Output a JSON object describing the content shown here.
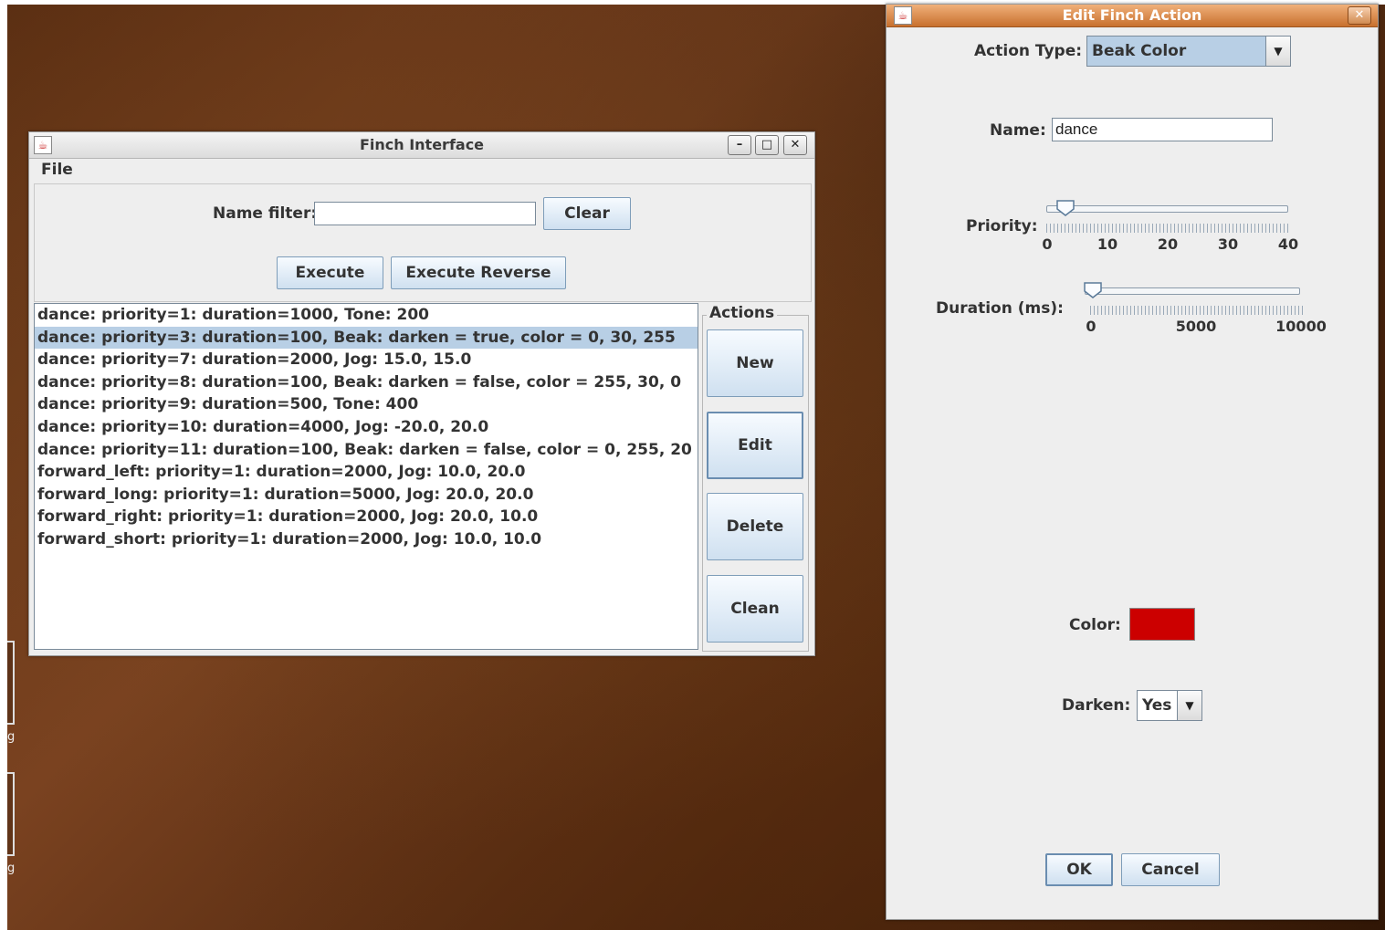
{
  "finch_window": {
    "title": "Finch Interface",
    "menu": {
      "file": "File"
    },
    "name_filter_label": "Name filter:",
    "name_filter_value": "",
    "clear_button": "Clear",
    "execute_button": "Execute",
    "execute_reverse_button": "Execute Reverse",
    "actions_group_title": "Actions",
    "new_button": "New",
    "edit_button": "Edit",
    "delete_button": "Delete",
    "clean_button": "Clean",
    "selected_index": 1,
    "items": [
      "dance: priority=1: duration=1000, Tone: 200",
      "dance: priority=3: duration=100, Beak: darken = true, color = 0, 30, 255",
      "dance: priority=7: duration=2000, Jog: 15.0, 15.0",
      "dance: priority=8: duration=100, Beak: darken = false, color = 255, 30, 0",
      "dance: priority=9: duration=500, Tone: 400",
      "dance: priority=10: duration=4000, Jog: -20.0, 20.0",
      "dance: priority=11: duration=100, Beak: darken = false, color = 0, 255, 20",
      "forward_left: priority=1: duration=2000, Jog: 10.0, 20.0",
      "forward_long: priority=1: duration=5000, Jog: 20.0, 20.0",
      "forward_right: priority=1: duration=2000, Jog: 20.0, 10.0",
      "forward_short: priority=1: duration=2000, Jog: 10.0, 10.0"
    ]
  },
  "edit_window": {
    "title": "Edit Finch Action",
    "action_type_label": "Action Type:",
    "action_type_value": "Beak Color",
    "name_label": "Name:",
    "name_value": "dance",
    "priority_label": "Priority:",
    "priority": {
      "value": 3,
      "min": 0,
      "max": 40,
      "tick_labels": [
        "0",
        "10",
        "20",
        "30",
        "40"
      ]
    },
    "duration_label": "Duration (ms):",
    "duration": {
      "value": 100,
      "min": 0,
      "max": 10000,
      "tick_labels": [
        "0",
        "5000",
        "10000"
      ]
    },
    "color_label": "Color:",
    "color_value": "#cc0000",
    "darken_label": "Darken:",
    "darken_value": "Yes",
    "ok_button": "OK",
    "cancel_button": "Cancel"
  },
  "desktop": {
    "icon_label_1": "g",
    "icon_label_2": "g"
  },
  "icons": {
    "java": "java-cup-icon",
    "minimize": "minimize-icon",
    "maximize": "maximize-icon",
    "close": "close-icon",
    "dropdown": "chevron-down-icon"
  }
}
